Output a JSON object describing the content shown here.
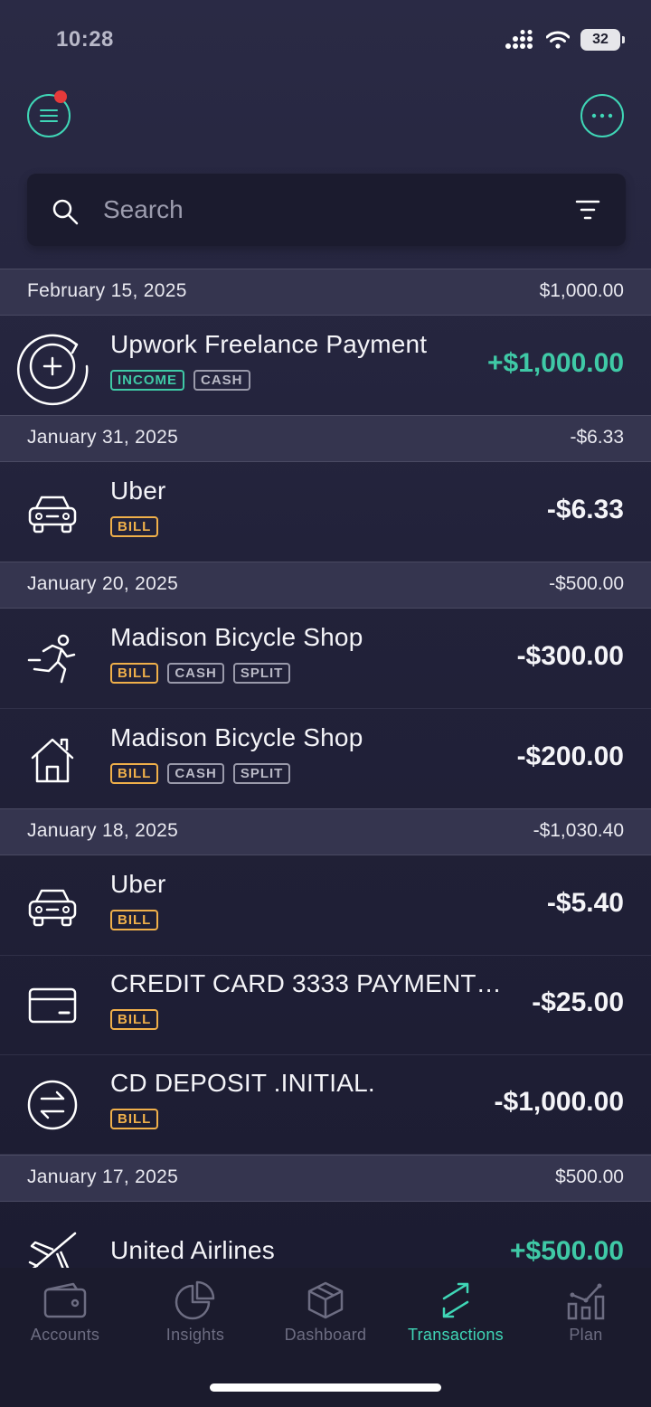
{
  "status_bar": {
    "time": "10:28",
    "battery": "32"
  },
  "search": {
    "placeholder": "Search"
  },
  "groups": [
    {
      "date": "February 15, 2025",
      "total": "$1,000.00",
      "transactions": [
        {
          "name": "Upwork Freelance Payment",
          "amount": "+$1,000.00",
          "tags": [
            "INCOME",
            "CASH"
          ],
          "icon": "income-cycle-icon"
        }
      ]
    },
    {
      "date": "January 31, 2025",
      "total": "-$6.33",
      "transactions": [
        {
          "name": "Uber",
          "amount": "-$6.33",
          "tags": [
            "BILL"
          ],
          "icon": "car-icon"
        }
      ]
    },
    {
      "date": "January 20, 2025",
      "total": "-$500.00",
      "transactions": [
        {
          "name": "Madison Bicycle Shop",
          "amount": "-$300.00",
          "tags": [
            "BILL",
            "CASH",
            "SPLIT"
          ],
          "icon": "running-icon"
        },
        {
          "name": "Madison Bicycle Shop",
          "amount": "-$200.00",
          "tags": [
            "BILL",
            "CASH",
            "SPLIT"
          ],
          "icon": "house-icon"
        }
      ]
    },
    {
      "date": "January 18, 2025",
      "total": "-$1,030.40",
      "transactions": [
        {
          "name": "Uber",
          "amount": "-$5.40",
          "tags": [
            "BILL"
          ],
          "icon": "car-icon"
        },
        {
          "name": "CREDIT CARD 3333 PAYMENT…",
          "amount": "-$25.00",
          "tags": [
            "BILL"
          ],
          "icon": "credit-card-icon"
        },
        {
          "name": "CD DEPOSIT .INITIAL.",
          "amount": "-$1,000.00",
          "tags": [
            "BILL"
          ],
          "icon": "transfer-icon"
        }
      ]
    },
    {
      "date": "January 17, 2025",
      "total": "$500.00",
      "transactions": [
        {
          "name": "United Airlines",
          "amount": "+$500.00",
          "tags": [],
          "icon": "airplane-icon"
        }
      ]
    }
  ],
  "nav": [
    {
      "label": "Accounts",
      "icon": "wallet-icon",
      "active": false
    },
    {
      "label": "Insights",
      "icon": "pie-chart-icon",
      "active": false
    },
    {
      "label": "Dashboard",
      "icon": "cube-icon",
      "active": false
    },
    {
      "label": "Transactions",
      "icon": "arrows-icon",
      "active": true
    },
    {
      "label": "Plan",
      "icon": "bar-chart-icon",
      "active": false
    }
  ],
  "colors": {
    "accent": "#3fd6b6",
    "positive": "#3fc9a6",
    "bill": "#f0b04a",
    "notification": "#e63a3a"
  }
}
